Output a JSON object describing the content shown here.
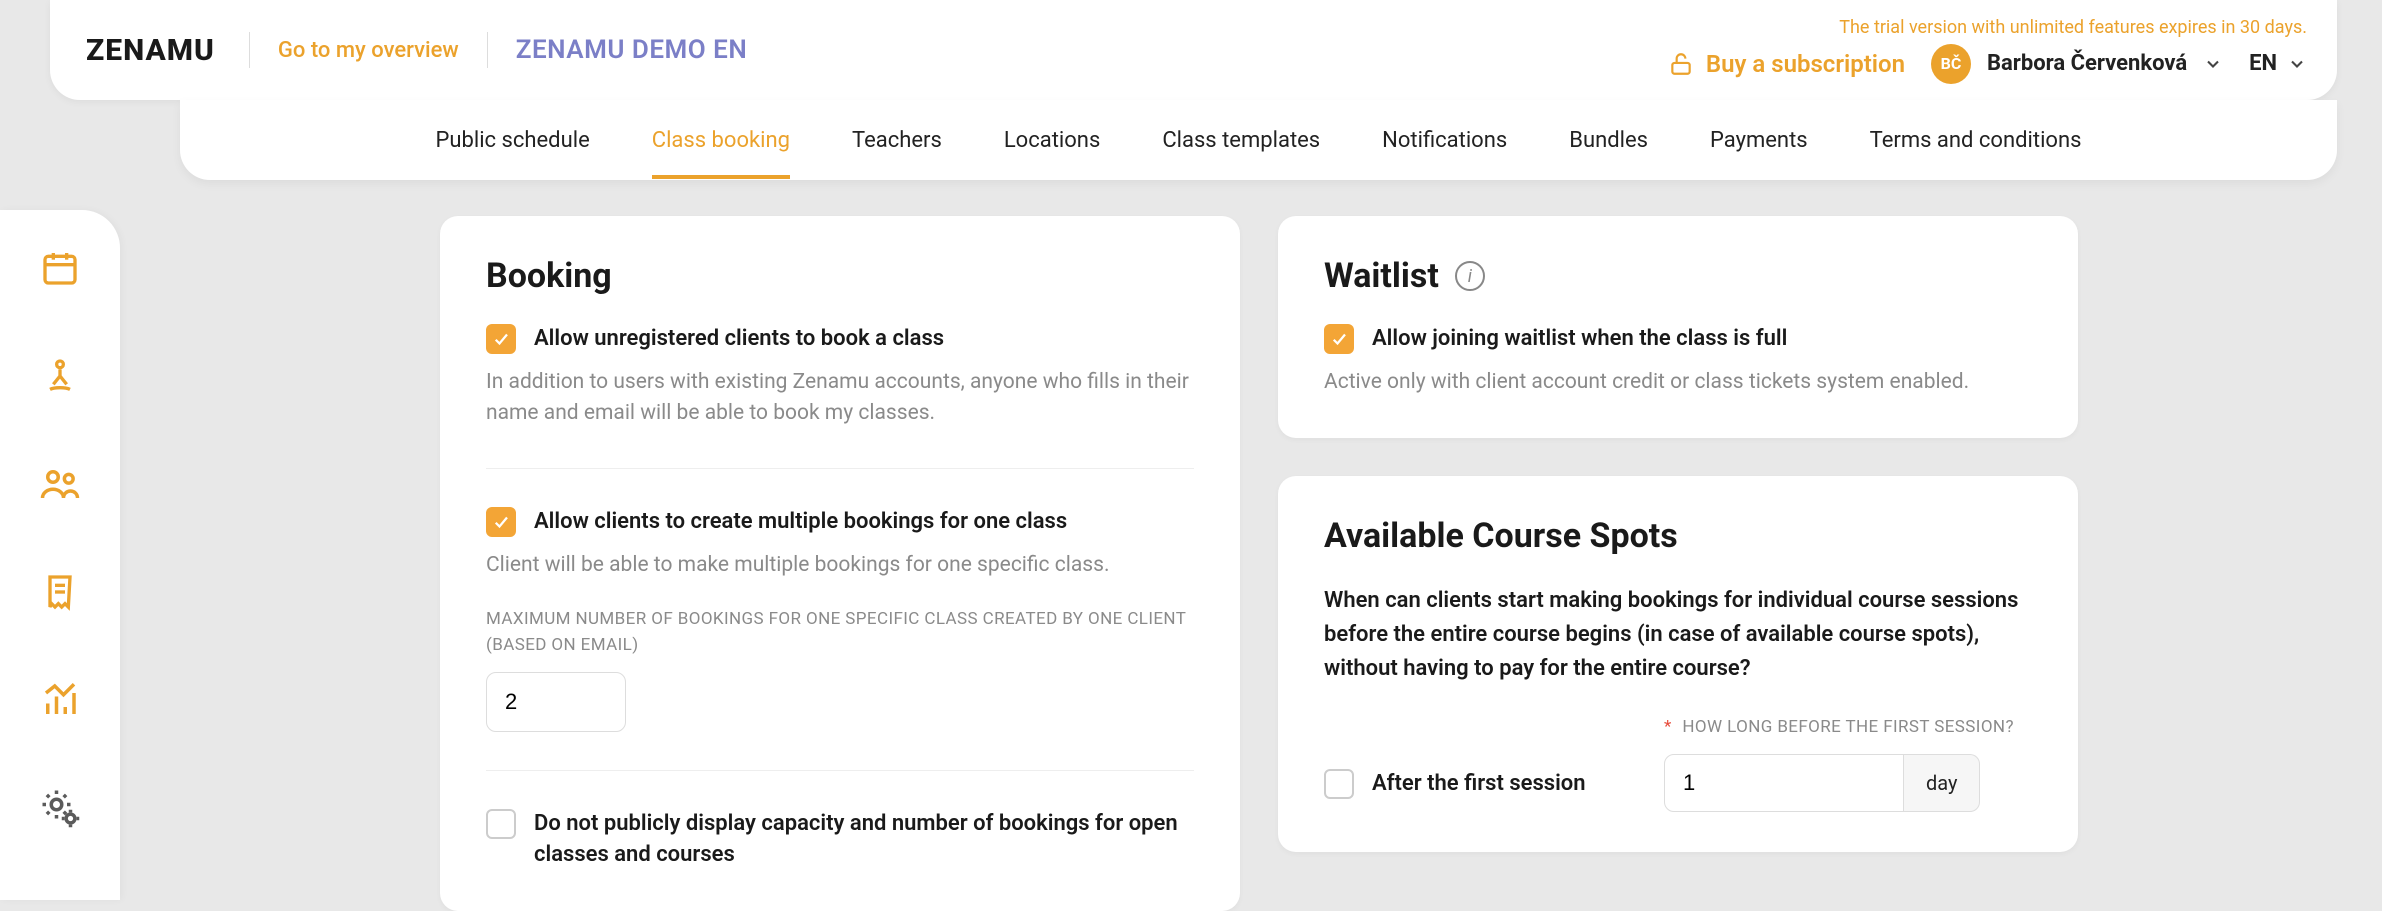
{
  "brand": "ZENAMU",
  "overview_label": "Go to my overview",
  "demo_title": "ZENAMU DEMO EN",
  "trial_msg": "The trial version with unlimited features expires in 30 days.",
  "buy_label": "Buy a subscription",
  "user": {
    "initials": "BČ",
    "name": "Barbora Červenková"
  },
  "lang": "EN",
  "nav": [
    "Public schedule",
    "Class booking",
    "Teachers",
    "Locations",
    "Class templates",
    "Notifications",
    "Bundles",
    "Payments",
    "Terms and conditions"
  ],
  "booking": {
    "heading": "Booking",
    "allow_unreg_label": "Allow unregistered clients to book a class",
    "allow_unreg_desc": "In addition to users with existing Zenamu accounts, anyone who fills in their name and email will be able to book my classes.",
    "allow_multi_label": "Allow clients to create multiple bookings for one class",
    "allow_multi_desc": "Client will be able to make multiple bookings for one specific class.",
    "max_label": "MAXIMUM NUMBER OF BOOKINGS FOR ONE SPECIFIC CLASS CREATED BY ONE CLIENT (BASED ON EMAIL)",
    "max_value": "2",
    "hide_capacity_label": "Do not publicly display capacity and number of bookings for open classes and courses"
  },
  "waitlist": {
    "heading": "Waitlist",
    "allow_label": "Allow joining waitlist when the class is full",
    "desc": "Active only with client account credit or class tickets system enabled."
  },
  "spots": {
    "heading": "Available Course Spots",
    "lead": "When can clients start making bookings for individual course sessions before the entire course begins (in case of available course spots), without having to pay for the entire course?",
    "after_label": "After the first session",
    "howlong_label": "HOW LONG BEFORE THE FIRST SESSION?",
    "value": "1",
    "unit": "day"
  }
}
